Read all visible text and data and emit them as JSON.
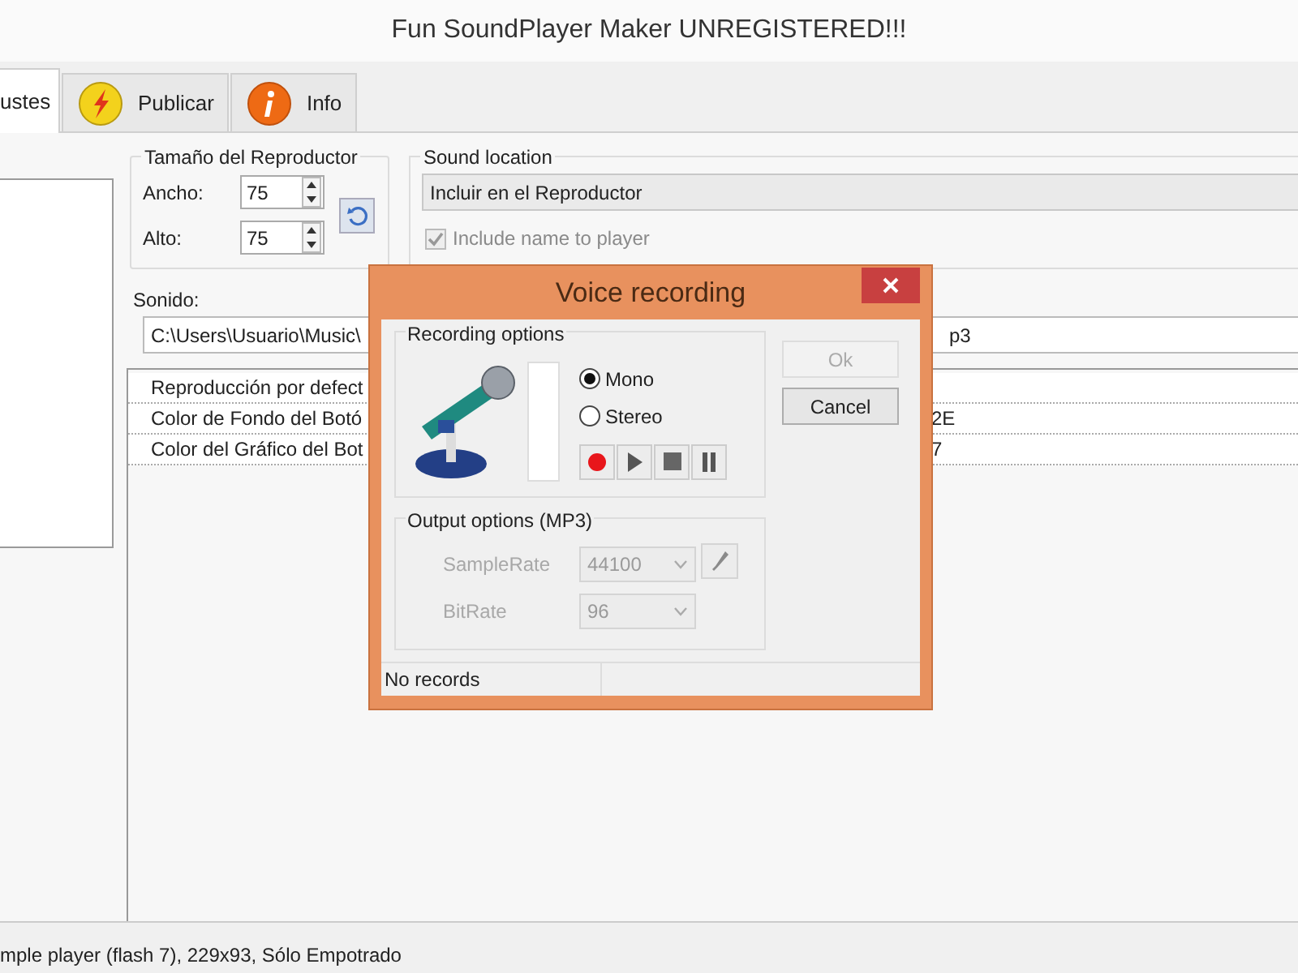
{
  "window": {
    "title": "Fun SoundPlayer Maker UNREGISTERED!!!"
  },
  "tabs": [
    {
      "label": "ustes",
      "kind": "plain",
      "selected": true
    },
    {
      "label": "Publicar",
      "kind": "bolt",
      "selected": false
    },
    {
      "label": "Info",
      "kind": "info",
      "selected": false
    }
  ],
  "player_size": {
    "title": "Tamaño del Reproductor",
    "fields": [
      {
        "label": "Ancho:",
        "value": "75"
      },
      {
        "label": "Alto:",
        "value": "75"
      }
    ]
  },
  "sound_location": {
    "title": "Sound location",
    "value": "Incluir en el Reproductor",
    "include_name": {
      "label": "Include name to player",
      "checked": true,
      "disabled": true
    }
  },
  "sound": {
    "label": "Sonido:",
    "path_start": "C:\\Users\\Usuario\\Music\\",
    "path_end": "p3"
  },
  "properties": [
    {
      "name": "Reproducción por defect"
    },
    {
      "name": "Color de Fondo del Botó",
      "value": "2E"
    },
    {
      "name": "Color del Gráfico del Bot",
      "value": "7"
    }
  ],
  "status_bar": "mple player (flash 7), 229x93, Sólo Empotrado",
  "dialog": {
    "title": "Voice recording",
    "recording_options": {
      "title": "Recording options",
      "channels": [
        {
          "label": "Mono",
          "selected": true
        },
        {
          "label": "Stereo",
          "selected": false
        }
      ],
      "controls": [
        {
          "kind": "record"
        },
        {
          "kind": "play"
        },
        {
          "kind": "stop"
        },
        {
          "kind": "pause"
        }
      ]
    },
    "buttons": [
      {
        "label": "Ok",
        "disabled": true
      },
      {
        "label": "Cancel",
        "disabled": false
      }
    ],
    "output_options": {
      "title": "Output options (MP3)",
      "fields": [
        {
          "label": "SampleRate",
          "value": "44100",
          "disabled": true
        },
        {
          "label": "BitRate",
          "value": "96",
          "disabled": true
        }
      ]
    },
    "status": "No records"
  }
}
